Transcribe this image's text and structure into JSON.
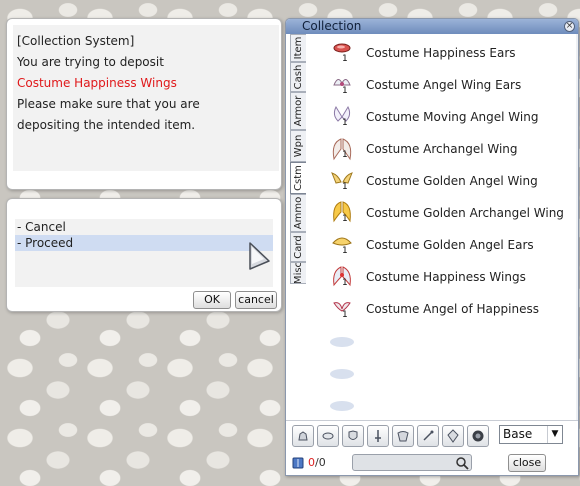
{
  "dialog": {
    "lines": [
      {
        "text": "[Collection System]",
        "color": "#222222"
      },
      {
        "text": "You are trying to deposit",
        "color": "#222222"
      },
      {
        "text": "Costume Happiness Wings",
        "color": "#e0181a"
      },
      {
        "text": "Please make sure that you are",
        "color": "#222222"
      },
      {
        "text": "depositing the intended item.",
        "color": "#222222"
      }
    ]
  },
  "menu": {
    "options": [
      "- Cancel",
      "- Proceed"
    ],
    "selected": "- Proceed",
    "ok_label": "OK",
    "cancel_label": "cancel"
  },
  "collection": {
    "title": "Collection",
    "tabs": [
      "Item",
      "Cash",
      "Armor",
      "Wpn",
      "Cstm",
      "Ammo",
      "Card",
      "Misc"
    ],
    "active_tab": "Cstm",
    "items": [
      {
        "name": "Costume Happiness Ears",
        "qty": "1",
        "icon": "ears-icon"
      },
      {
        "name": "Costume Angel Wing Ears",
        "qty": "1",
        "icon": "wing-ears-icon"
      },
      {
        "name": "Costume Moving Angel Wing",
        "qty": "1",
        "icon": "angel-wing-icon"
      },
      {
        "name": "Costume Archangel Wing",
        "qty": "1",
        "icon": "archangel-wing-icon"
      },
      {
        "name": "Costume Golden Angel Wing",
        "qty": "1",
        "icon": "golden-wing-icon"
      },
      {
        "name": "Costume Golden Archangel Wing",
        "qty": "1",
        "icon": "golden-archangel-wing-icon"
      },
      {
        "name": "Costume Golden Angel Ears",
        "qty": "1",
        "icon": "golden-ears-icon"
      },
      {
        "name": "Costume Happiness Wings",
        "qty": "1",
        "icon": "happiness-wings-icon"
      },
      {
        "name": "Costume Angel of Happiness",
        "qty": "1",
        "icon": "angel-happiness-icon"
      }
    ],
    "empty_slots": 3,
    "filter_icons": [
      "top-headgear-icon",
      "mid-headgear-icon",
      "armor-icon",
      "weapon-icon",
      "garment-icon",
      "accessory-icon",
      "shield-icon",
      "shadow-icon"
    ],
    "sort_select": "Base",
    "count_current": "0",
    "count_total": "/0",
    "search_placeholder": "",
    "close_label": "close"
  }
}
